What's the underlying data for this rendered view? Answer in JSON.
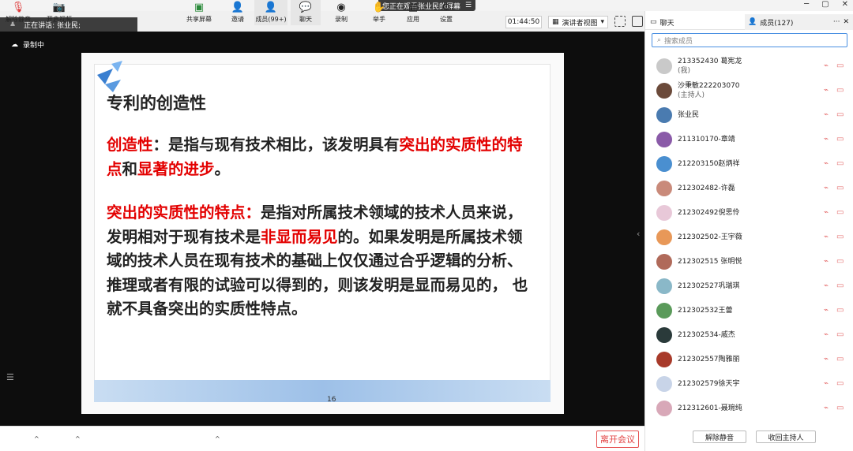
{
  "window": {
    "share_banner": "您正在观看张业民的屏幕",
    "menu_glyph": "☰",
    "controls": [
      "─",
      "▢",
      "✕"
    ]
  },
  "speaker": {
    "label": "正在讲话: 张业民;"
  },
  "recording": {
    "label": "录制中"
  },
  "toolbar": {
    "time": "01:44:50",
    "view_mode": "演讲者视图",
    "view_caret": "▾"
  },
  "slide": {
    "title": "专利的创造性",
    "p1_term": "创造性",
    "p1_text": "：是指与现有技术相比，该发明具有",
    "p1_red1": "突出的",
    "p1_red2": "实质性的特点",
    "p1_and": "和",
    "p1_red3": "显著的进步",
    "p1_end": "。",
    "p2_term": "突出的实质性的特点：",
    "p2_text1": "是指对所属技术领域的技术人员来说，发明相对于现有技术是",
    "p2_red": "非显而易见",
    "p2_text2": "的。如果发明是所属技术领域的技术人员在现有技术的基础上仅仅通过合乎逻辑的分析、推理或者有限的试验可以得到的，则该发明是显而易见的， 也就不具备突出的实质性特点。",
    "page_number": "16"
  },
  "bottombar": {
    "unmute": "解除静音",
    "start_video": "开启视频",
    "share_screen": "共享屏幕",
    "invite": "邀请",
    "members": "成员(99+)",
    "chat": "聊天",
    "record": "录制",
    "raise_hand": "举手",
    "apps": "应用",
    "settings": "设置",
    "leave": "离开会议"
  },
  "panel": {
    "chat_tab": "聊天",
    "members_tab": "成员(127)",
    "more": "···",
    "close": "✕",
    "search_placeholder": "搜索成员",
    "members": [
      {
        "name": "213352430 葛宪龙",
        "sub": "(我)",
        "color": "#c9c9c9"
      },
      {
        "name": "沙秉敏222203070",
        "sub": "(主持人)",
        "color": "#6b4a3a"
      },
      {
        "name": "张业民",
        "sub": "",
        "color": "#4a7bb0"
      },
      {
        "name": "211310170-章靖",
        "sub": "",
        "color": "#8a5aa8"
      },
      {
        "name": "212203150赵炳祥",
        "sub": "",
        "color": "#4a8fd0"
      },
      {
        "name": "212302482-许磊",
        "sub": "",
        "color": "#c98a7a"
      },
      {
        "name": "212302492倪思伶",
        "sub": "",
        "color": "#e8c8d8"
      },
      {
        "name": "212302502-王宇薇",
        "sub": "",
        "color": "#e89858"
      },
      {
        "name": "212302515 张明悦",
        "sub": "",
        "color": "#b06a5a"
      },
      {
        "name": "212302527巩瑞琪",
        "sub": "",
        "color": "#8ab8c8"
      },
      {
        "name": "212302532王蕾",
        "sub": "",
        "color": "#5a9a5a"
      },
      {
        "name": "212302534-戚杰",
        "sub": "",
        "color": "#2a3a3a"
      },
      {
        "name": "212302557陶雅丽",
        "sub": "",
        "color": "#a83a2a"
      },
      {
        "name": "212302579徐天宇",
        "sub": "",
        "color": "#c8d4e8"
      },
      {
        "name": "212312601-聂琬纯",
        "sub": "",
        "color": "#d8a8b8"
      }
    ],
    "unmute_all": "解除静音",
    "reclaim_host": "收回主持人"
  }
}
